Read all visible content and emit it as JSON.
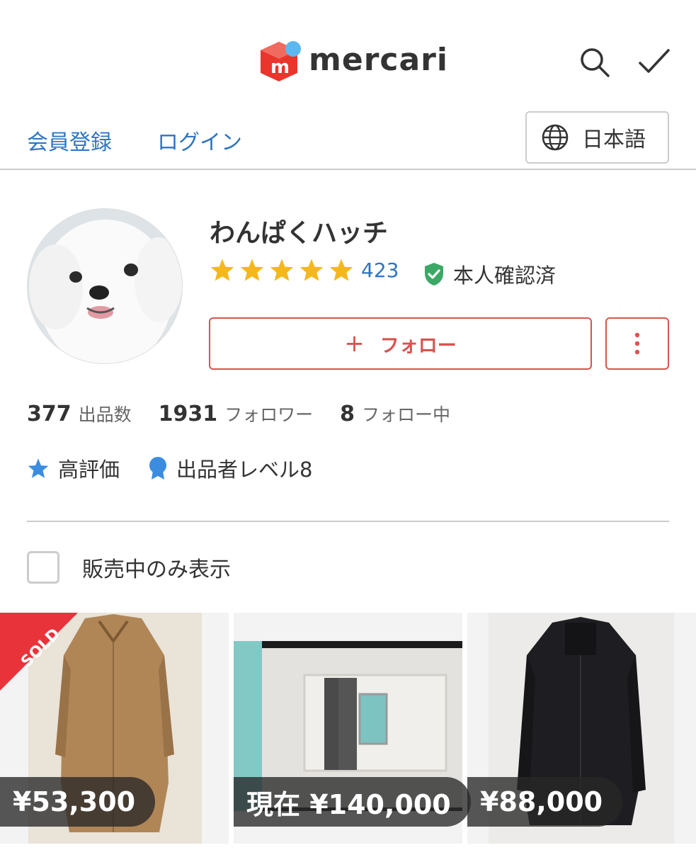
{
  "header": {
    "logo_text": "mercari",
    "logo_mark": "m",
    "icons": [
      "search-icon",
      "check-icon"
    ]
  },
  "nav": {
    "signup_label": "会員登録",
    "login_label": "ログイン",
    "language_label": "日本語"
  },
  "profile": {
    "username": "わんぱくハッチ",
    "rating_stars": 5,
    "rating_count": "423",
    "verified_label": "本人確認済",
    "follow_button": {
      "plus": "+",
      "label": "フォロー"
    },
    "stats": [
      {
        "value": "377",
        "label": "出品数"
      },
      {
        "value": "1931",
        "label": "フォロワー"
      },
      {
        "value": "8",
        "label": "フォロー中"
      }
    ],
    "badges": {
      "high_rating": "高評価",
      "seller_level": "出品者レベル8"
    }
  },
  "filter": {
    "on_sale_only_label": "販売中のみ表示",
    "checked": false
  },
  "items": [
    {
      "price": "¥53,300",
      "sold": true,
      "sold_label": "SOLD"
    },
    {
      "price": "現在 ¥140,000",
      "sold": false
    },
    {
      "price": "¥88,000",
      "sold": false
    }
  ],
  "colors": {
    "accent_red": "#d9534f",
    "link_blue": "#2f74c0",
    "star_yellow": "#f5b81c",
    "verified_green": "#3aa866",
    "logo_red": "#ea352d",
    "logo_dot": "#5cb8f0"
  }
}
